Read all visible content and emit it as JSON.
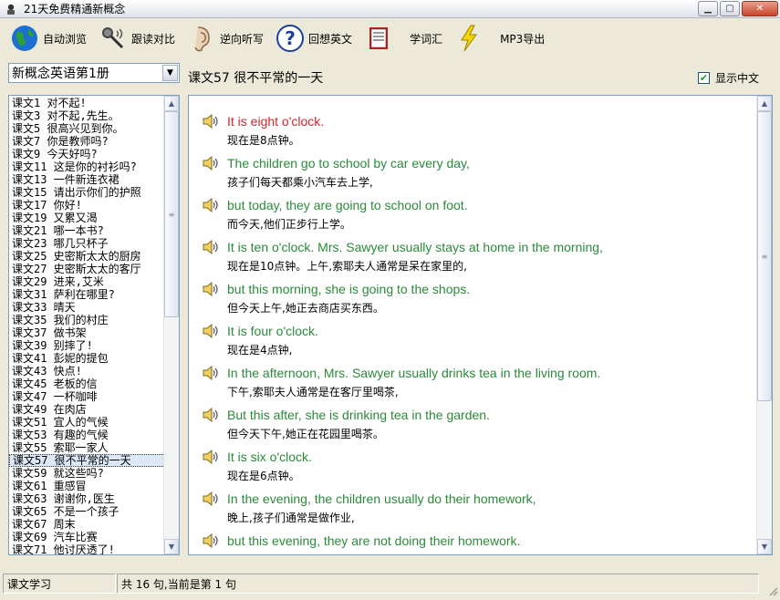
{
  "window": {
    "title": "21天免费精通新概念",
    "buttons": [
      "minimize",
      "maximize",
      "close"
    ]
  },
  "toolbar": {
    "items": [
      {
        "label": "自动浏览",
        "icon": "globe-icon"
      },
      {
        "label": "跟读对比",
        "icon": "microphone-icon"
      },
      {
        "label": "逆向听写",
        "icon": "ear-icon"
      },
      {
        "label": "回想英文",
        "icon": "question-icon"
      },
      {
        "label": "",
        "icon": "book-icon"
      },
      {
        "label": "学词汇",
        "icon": ""
      },
      {
        "label": "",
        "icon": "lightning-icon"
      },
      {
        "label": "MP3导出",
        "icon": ""
      }
    ]
  },
  "book_select": {
    "value": "新概念英语第1册"
  },
  "lesson_title": "课文57 很不平常的一天",
  "show_chinese": {
    "label": "显示中文",
    "checked": true
  },
  "lesson_list": {
    "selected_index": 28,
    "items": [
      "课文1 对不起!",
      "课文3 对不起,先生。",
      "课文5 很高兴见到你。",
      "课文7 你是教师吗?",
      "课文9 今天好吗?",
      "课文11 这是你的衬衫吗?",
      "课文13 一件新连衣裙",
      "课文15 请出示你们的护照",
      "课文17 你好!",
      "课文19 又累又渴",
      "课文21 哪一本书?",
      "课文23 哪几只杯子",
      "课文25 史密斯太太的厨房",
      "课文27 史密斯太太的客厅",
      "课文29 进来,艾米",
      "课文31 萨利在哪里?",
      "课文33 晴天",
      "课文35 我们的村庄",
      "课文37 做书架",
      "课文39 别摔了!",
      "课文41 彭妮的提包",
      "课文43 快点!",
      "课文45 老板的信",
      "课文47 一杯咖啡",
      "课文49 在肉店",
      "课文51 宜人的气候",
      "课文53 有趣的气候",
      "课文55 索耶一家人",
      "课文57 很不平常的一天",
      "课文59 就这些吗?",
      "课文61 重感冒",
      "课文63 谢谢你,医生",
      "课文65 不是一个孩子",
      "课文67 周末",
      "课文69 汽车比赛",
      "课文71 他讨厌透了!"
    ]
  },
  "sentences": [
    {
      "en": "It is eight o'clock.",
      "cn": "现在是8点钟。",
      "active": true
    },
    {
      "en": "The children go to school by car every day,",
      "cn": "孩子们每天都乘小汽车去上学,"
    },
    {
      "en": "but today, they are going to school on foot.",
      "cn": "而今天,他们正步行上学。"
    },
    {
      "en": "It is ten o'clock. Mrs. Sawyer usually stays at home in the morning,",
      "cn": "现在是10点钟。上午,索耶夫人通常是呆在家里的,"
    },
    {
      "en": "but this morning, she is going to the shops.",
      "cn": "但今天上午,她正去商店买东西。"
    },
    {
      "en": "It is four o'clock.",
      "cn": "现在是4点钟,"
    },
    {
      "en": "In the afternoon, Mrs. Sawyer usually drinks tea in the living room.",
      "cn": "下午,索耶夫人通常是在客厅里喝茶,"
    },
    {
      "en": "But this after, she is drinking tea in the garden.",
      "cn": "但今天下午,她正在花园里喝茶。"
    },
    {
      "en": "It is six o'clock.",
      "cn": "现在是6点钟。"
    },
    {
      "en": "In the evening, the children usually do their homework,",
      "cn": "晚上,孩子们通常是做作业,"
    },
    {
      "en": "but this evening, they are not doing their homework.",
      "cn": ""
    }
  ],
  "status": {
    "left": "课文学习",
    "right": "共 16 句,当前是第 1 句"
  },
  "colors": {
    "english_text": "#2a8a3a",
    "active_text": "#d0272f",
    "window_bg": "#ece9d8"
  }
}
